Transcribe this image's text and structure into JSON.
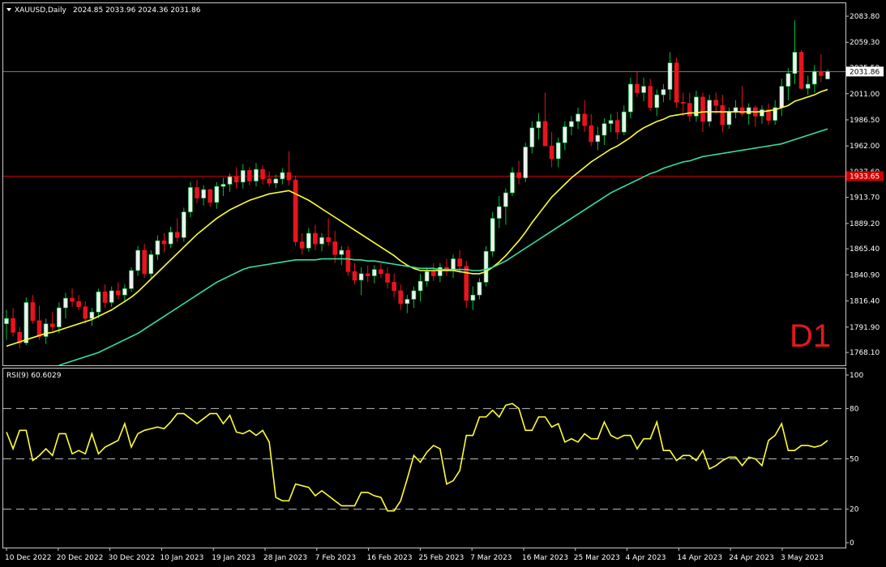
{
  "header": {
    "symbol": "XAUUSD,Daily",
    "ohlc": "2024.85 2033.96 2024.36 2031.86",
    "rsi_label": "RSI(9) 60.6029",
    "timeframe_badge": "D1"
  },
  "colors": {
    "background": "#000000",
    "bull": "#f0f0f0",
    "bear": "#e8141e",
    "ma_fast": "#ffff33",
    "ma_slow": "#33e1a0",
    "rsi": "#ffff33",
    "res_line": "#cc0000",
    "bid_line": "#7f7f7f"
  },
  "chart_data": [
    {
      "type": "candlestick",
      "title": "XAUUSD,Daily",
      "ylim": [
        1756,
        2096
      ],
      "price_ticks": [
        "2083.80",
        "2059.30",
        "2035.50",
        "2011.00",
        "1986.50",
        "1962.00",
        "1937.60",
        "1913.70",
        "1889.20",
        "1865.40",
        "1840.90",
        "1816.40",
        "1791.90",
        "1768.10"
      ],
      "x_labels": [
        "10 Dec 2022",
        "20 Dec 2022",
        "30 Dec 2022",
        "10 Jan 2023",
        "19 Jan 2023",
        "28 Jan 2023",
        "7 Feb 2023",
        "16 Feb 2023",
        "25 Feb 2023",
        "7 Mar 2023",
        "16 Mar 2023",
        "25 Mar 2023",
        "4 Apr 2023",
        "14 Apr 2023",
        "24 Apr 2023",
        "3 May 2023"
      ],
      "current_price_label": "2031.86",
      "resistance_label": "1933.65",
      "resistance_level": 1933.65,
      "current_price": 2031.86,
      "ohlc": [
        [
          1795,
          1808,
          1780,
          1800
        ],
        [
          1800,
          1810,
          1783,
          1787
        ],
        [
          1787,
          1792,
          1772,
          1777
        ],
        [
          1777,
          1820,
          1775,
          1815
        ],
        [
          1815,
          1822,
          1795,
          1798
        ],
        [
          1798,
          1812,
          1780,
          1783
        ],
        [
          1783,
          1800,
          1776,
          1795
        ],
        [
          1795,
          1806,
          1788,
          1792
        ],
        [
          1792,
          1815,
          1786,
          1810
        ],
        [
          1810,
          1824,
          1800,
          1819
        ],
        [
          1819,
          1828,
          1811,
          1816
        ],
        [
          1816,
          1822,
          1808,
          1811
        ],
        [
          1811,
          1816,
          1795,
          1800
        ],
        [
          1800,
          1810,
          1793,
          1806
        ],
        [
          1806,
          1828,
          1800,
          1825
        ],
        [
          1825,
          1832,
          1810,
          1815
        ],
        [
          1815,
          1830,
          1811,
          1826
        ],
        [
          1826,
          1834,
          1818,
          1822
        ],
        [
          1822,
          1832,
          1815,
          1828
        ],
        [
          1828,
          1848,
          1825,
          1845
        ],
        [
          1845,
          1868,
          1840,
          1864
        ],
        [
          1864,
          1870,
          1838,
          1842
        ],
        [
          1842,
          1864,
          1838,
          1860
        ],
        [
          1860,
          1878,
          1855,
          1873
        ],
        [
          1873,
          1880,
          1862,
          1870
        ],
        [
          1870,
          1886,
          1866,
          1881
        ],
        [
          1881,
          1894,
          1872,
          1876
        ],
        [
          1876,
          1904,
          1872,
          1900
        ],
        [
          1900,
          1928,
          1895,
          1923
        ],
        [
          1923,
          1930,
          1908,
          1913
        ],
        [
          1913,
          1925,
          1906,
          1921
        ],
        [
          1921,
          1922,
          1905,
          1909
        ],
        [
          1909,
          1928,
          1903,
          1924
        ],
        [
          1924,
          1932,
          1915,
          1926
        ],
        [
          1926,
          1936,
          1919,
          1933
        ],
        [
          1933,
          1942,
          1922,
          1928
        ],
        [
          1928,
          1945,
          1922,
          1939
        ],
        [
          1939,
          1942,
          1925,
          1929
        ],
        [
          1929,
          1946,
          1924,
          1940
        ],
        [
          1940,
          1944,
          1926,
          1931
        ],
        [
          1931,
          1938,
          1924,
          1927
        ],
        [
          1927,
          1935,
          1922,
          1931
        ],
        [
          1931,
          1941,
          1926,
          1937
        ],
        [
          1937,
          1957,
          1925,
          1930
        ],
        [
          1930,
          1934,
          1868,
          1872
        ],
        [
          1872,
          1880,
          1860,
          1866
        ],
        [
          1866,
          1885,
          1863,
          1880
        ],
        [
          1880,
          1888,
          1864,
          1870
        ],
        [
          1870,
          1880,
          1863,
          1876
        ],
        [
          1876,
          1894,
          1868,
          1872
        ],
        [
          1872,
          1882,
          1852,
          1860
        ],
        [
          1860,
          1868,
          1850,
          1864
        ],
        [
          1864,
          1868,
          1840,
          1844
        ],
        [
          1844,
          1852,
          1832,
          1836
        ],
        [
          1836,
          1848,
          1822,
          1842
        ],
        [
          1842,
          1850,
          1834,
          1840
        ],
        [
          1840,
          1850,
          1833,
          1846
        ],
        [
          1846,
          1852,
          1838,
          1842
        ],
        [
          1842,
          1848,
          1828,
          1834
        ],
        [
          1834,
          1842,
          1820,
          1826
        ],
        [
          1826,
          1832,
          1808,
          1814
        ],
        [
          1814,
          1822,
          1805,
          1818
        ],
        [
          1818,
          1830,
          1810,
          1826
        ],
        [
          1826,
          1842,
          1816,
          1835
        ],
        [
          1835,
          1848,
          1830,
          1844
        ],
        [
          1844,
          1852,
          1835,
          1840
        ],
        [
          1840,
          1852,
          1834,
          1848
        ],
        [
          1848,
          1856,
          1840,
          1845
        ],
        [
          1845,
          1860,
          1838,
          1856
        ],
        [
          1856,
          1864,
          1842,
          1849
        ],
        [
          1849,
          1854,
          1810,
          1817
        ],
        [
          1817,
          1830,
          1808,
          1822
        ],
        [
          1822,
          1838,
          1818,
          1834
        ],
        [
          1834,
          1868,
          1830,
          1863
        ],
        [
          1863,
          1900,
          1858,
          1894
        ],
        [
          1894,
          1915,
          1885,
          1905
        ],
        [
          1905,
          1922,
          1888,
          1918
        ],
        [
          1918,
          1942,
          1915,
          1937
        ],
        [
          1937,
          1948,
          1926,
          1932
        ],
        [
          1932,
          1965,
          1928,
          1961
        ],
        [
          1961,
          1985,
          1955,
          1979
        ],
        [
          1979,
          1993,
          1968,
          1985
        ],
        [
          1985,
          2012,
          1980,
          1962
        ],
        [
          1962,
          1975,
          1942,
          1950
        ],
        [
          1950,
          1970,
          1942,
          1965
        ],
        [
          1965,
          1985,
          1958,
          1980
        ],
        [
          1980,
          1990,
          1972,
          1985
        ],
        [
          1985,
          1998,
          1978,
          1992
        ],
        [
          1992,
          2005,
          1975,
          1981
        ],
        [
          1981,
          1992,
          1962,
          1966
        ],
        [
          1966,
          1980,
          1958,
          1972
        ],
        [
          1972,
          1988,
          1963,
          1983
        ],
        [
          1983,
          1992,
          1975,
          1986
        ],
        [
          1986,
          1994,
          1968,
          1975
        ],
        [
          1975,
          2000,
          1972,
          1994
        ],
        [
          1994,
          2026,
          1988,
          2020
        ],
        [
          2020,
          2032,
          2008,
          2012
        ],
        [
          2012,
          2026,
          2004,
          2018
        ],
        [
          2018,
          2025,
          1995,
          1998
        ],
        [
          1998,
          2015,
          1990,
          2010
        ],
        [
          2010,
          2020,
          2003,
          2015
        ],
        [
          2015,
          2050,
          2005,
          2040
        ],
        [
          2040,
          2045,
          1998,
          2003
        ],
        [
          2003,
          2012,
          1990,
          2002
        ],
        [
          2002,
          2012,
          1985,
          1990
        ],
        [
          1990,
          2014,
          1985,
          2008
        ],
        [
          2008,
          2012,
          1975,
          1985
        ],
        [
          1985,
          2010,
          1980,
          2005
        ],
        [
          2005,
          2012,
          1992,
          2000
        ],
        [
          2000,
          2010,
          1975,
          1982
        ],
        [
          1982,
          1998,
          1978,
          1994
        ],
        [
          1994,
          2005,
          1988,
          1998
        ],
        [
          1998,
          2018,
          1990,
          1992
        ],
        [
          1992,
          2002,
          1982,
          1998
        ],
        [
          1998,
          2000,
          1980,
          1990
        ],
        [
          1990,
          2000,
          1983,
          1996
        ],
        [
          1996,
          2002,
          1982,
          1986
        ],
        [
          1986,
          2005,
          1982,
          1998
        ],
        [
          1998,
          2025,
          1990,
          2018
        ],
        [
          2018,
          2035,
          2005,
          2030
        ],
        [
          2030,
          2080,
          2020,
          2050
        ],
        [
          2050,
          2052,
          2015,
          2016
        ],
        [
          2016,
          2028,
          2010,
          2020
        ],
        [
          2020,
          2038,
          2012,
          2032
        ],
        [
          2032,
          2048,
          2022,
          2028
        ],
        [
          2024.85,
          2033.96,
          2024.36,
          2031.86
        ]
      ],
      "ma_fast": [
        1774,
        1776,
        1778,
        1780,
        1782,
        1784,
        1786,
        1787,
        1789,
        1791,
        1793,
        1795,
        1797,
        1799,
        1802,
        1805,
        1808,
        1812,
        1816,
        1820,
        1825,
        1831,
        1837,
        1843,
        1849,
        1855,
        1861,
        1867,
        1873,
        1879,
        1884,
        1889,
        1894,
        1898,
        1902,
        1905,
        1908,
        1911,
        1913,
        1915,
        1917,
        1918,
        1919,
        1920,
        1917,
        1914,
        1911,
        1907,
        1903,
        1899,
        1895,
        1891,
        1887,
        1883,
        1879,
        1875,
        1871,
        1867,
        1863,
        1859,
        1854,
        1850,
        1847,
        1845,
        1845,
        1845,
        1845,
        1845,
        1845,
        1844,
        1843,
        1842,
        1842,
        1844,
        1848,
        1853,
        1859,
        1866,
        1873,
        1881,
        1890,
        1898,
        1906,
        1914,
        1920,
        1926,
        1932,
        1937,
        1942,
        1947,
        1951,
        1955,
        1959,
        1962,
        1966,
        1970,
        1975,
        1979,
        1982,
        1985,
        1987,
        1990,
        1991,
        1992,
        1993,
        1993,
        1994,
        1994,
        1994,
        1994,
        1994,
        1994,
        1994,
        1994,
        1994,
        1994,
        1995,
        1996,
        1998,
        2000,
        2004,
        2006,
        2008,
        2010,
        2013,
        2015
      ],
      "ma_slow": [
        1740,
        1742,
        1744,
        1746,
        1748,
        1750,
        1752,
        1754,
        1756,
        1758,
        1760,
        1762,
        1764,
        1766,
        1768,
        1771,
        1774,
        1777,
        1780,
        1783,
        1786,
        1790,
        1794,
        1798,
        1802,
        1806,
        1810,
        1814,
        1818,
        1822,
        1826,
        1830,
        1834,
        1837,
        1840,
        1843,
        1846,
        1848,
        1849,
        1850,
        1851,
        1852,
        1853,
        1854,
        1855,
        1855,
        1855,
        1855,
        1856,
        1856,
        1856,
        1856,
        1856,
        1855,
        1855,
        1854,
        1854,
        1853,
        1852,
        1851,
        1850,
        1849,
        1848,
        1847,
        1847,
        1847,
        1846,
        1846,
        1846,
        1846,
        1846,
        1845,
        1845,
        1846,
        1848,
        1851,
        1854,
        1858,
        1862,
        1866,
        1870,
        1874,
        1878,
        1882,
        1886,
        1890,
        1894,
        1898,
        1902,
        1906,
        1910,
        1914,
        1918,
        1921,
        1924,
        1927,
        1930,
        1933,
        1936,
        1938,
        1941,
        1943,
        1945,
        1947,
        1948,
        1950,
        1952,
        1953,
        1954,
        1955,
        1956,
        1957,
        1958,
        1959,
        1960,
        1961,
        1962,
        1963,
        1964,
        1966,
        1968,
        1970,
        1972,
        1974,
        1976,
        1978
      ]
    },
    {
      "type": "line",
      "title": "RSI(9) 60.6029",
      "ylim": [
        0,
        100
      ],
      "levels": [
        80,
        50,
        20
      ],
      "y_ticks": [
        "100",
        "80",
        "50",
        "20",
        "0"
      ],
      "values": [
        66,
        56,
        67,
        67,
        49,
        52,
        56,
        52,
        65,
        65,
        53,
        55,
        53,
        65,
        53,
        57,
        59,
        61,
        71,
        57,
        65,
        67,
        68,
        69,
        68,
        72,
        77,
        77,
        74,
        71,
        74,
        77,
        77,
        71,
        76,
        66,
        65,
        67,
        64,
        67,
        60,
        27,
        25,
        25,
        35,
        34,
        33,
        28,
        31,
        28,
        25,
        22,
        22,
        22,
        30,
        30,
        28,
        27,
        19,
        19,
        25,
        38,
        52,
        48,
        54,
        58,
        56,
        35,
        37,
        43,
        64,
        64,
        75,
        75,
        79,
        75,
        82,
        83,
        80,
        67,
        67,
        75,
        75,
        69,
        71,
        60,
        62,
        60,
        65,
        62,
        62,
        72,
        64,
        62,
        64,
        64,
        56,
        62,
        62,
        72,
        55,
        55,
        49,
        52,
        52,
        49,
        55,
        44,
        46,
        49,
        51,
        51,
        46,
        51,
        50,
        46,
        61,
        64,
        71,
        55,
        55,
        58,
        58,
        57,
        58,
        61
      ]
    }
  ]
}
